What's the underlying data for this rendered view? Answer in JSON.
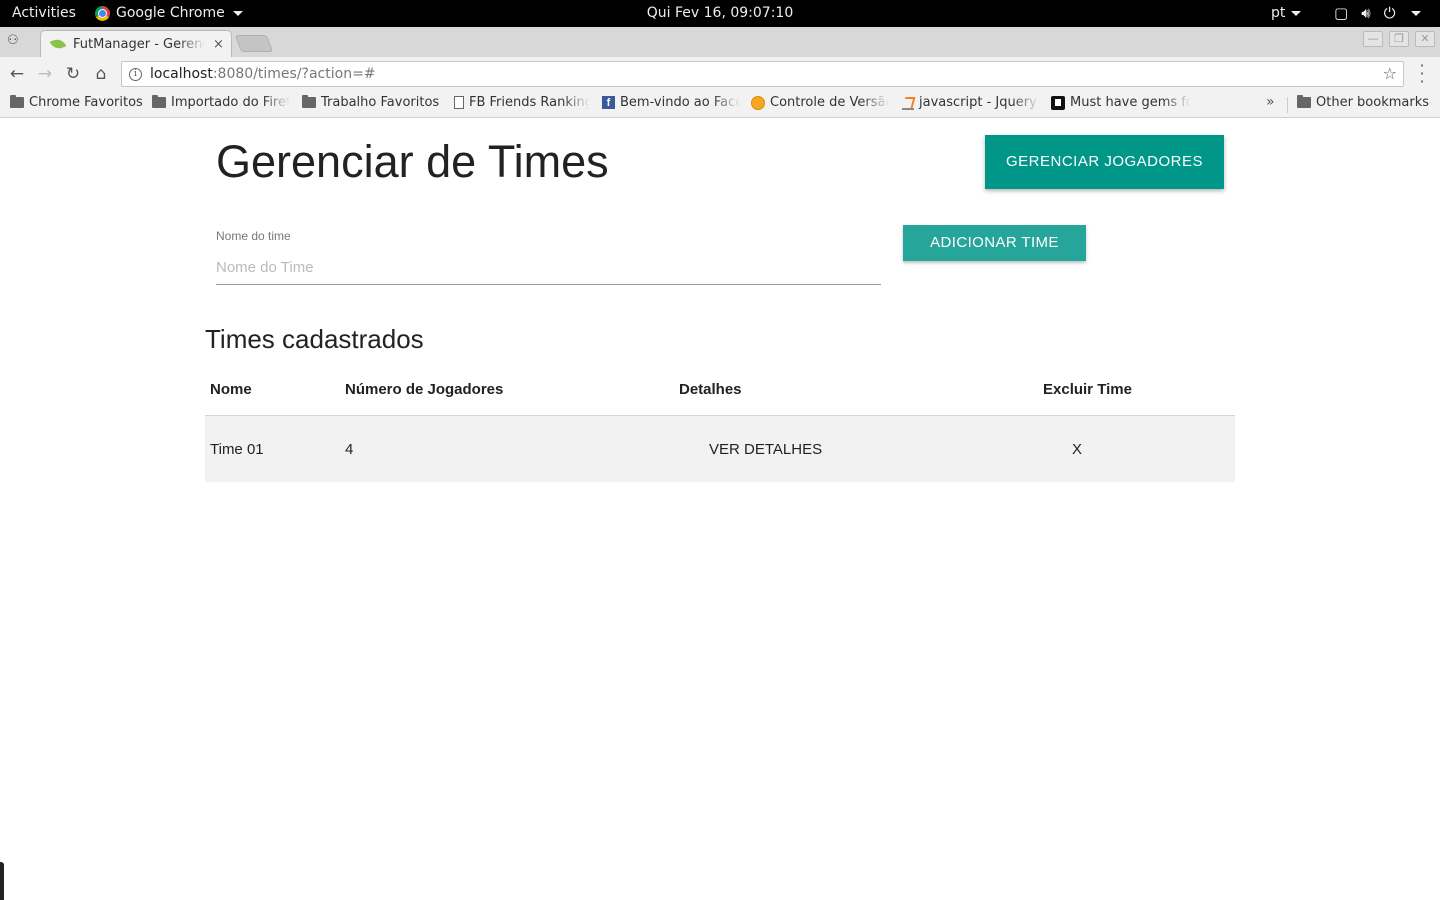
{
  "topbar": {
    "activities": "Activities",
    "app_name": "Google Chrome",
    "clock": "Qui Fev 16, 09:07:10",
    "language": "pt"
  },
  "tabs": [
    {
      "title": "FutManager - Gerenciar de Times",
      "close": "×"
    }
  ],
  "window_controls": {
    "minimize": "—",
    "maximize": "❐",
    "close": "✕"
  },
  "toolbar": {
    "url_host": "localhost",
    "url_rest": ":8080/times/?action=#"
  },
  "bookmarks": {
    "items": [
      {
        "label": "Chrome Favoritos",
        "icon": "folder-icon"
      },
      {
        "label": "Importado do Firefox",
        "icon": "folder-icon"
      },
      {
        "label": "Trabalho Favoritos",
        "icon": "folder-icon"
      },
      {
        "label": "FB Friends Ranking",
        "icon": "page-icon"
      },
      {
        "label": "Bem-vindo ao Facebook",
        "icon": "facebook-icon"
      },
      {
        "label": "Controle de Versão",
        "icon": "globe-icon"
      },
      {
        "label": "javascript - Jquery",
        "icon": "stackoverflow-icon"
      },
      {
        "label": "Must have gems for",
        "icon": "gems-icon"
      }
    ],
    "overflow": "»",
    "other": "Other bookmarks"
  },
  "page": {
    "title": "Gerenciar de Times",
    "manage_players_button": "GERENCIAR JOGADORES",
    "team_name_label": "Nome do time",
    "team_name_placeholder": "Nome do Time",
    "team_name_value": "",
    "add_team_button": "ADICIONAR TIME",
    "section_title": "Times cadastrados",
    "table": {
      "headers": [
        "Nome",
        "Número de Jogadores",
        "Detalhes",
        "Excluir Time"
      ],
      "rows": [
        {
          "name": "Time 01",
          "players": "4",
          "details": "VER DETALHES",
          "delete": "X"
        }
      ]
    }
  },
  "colors": {
    "primary_button": "#009688",
    "add_button": "#26a69a",
    "row_background": "#f2f2f2"
  }
}
